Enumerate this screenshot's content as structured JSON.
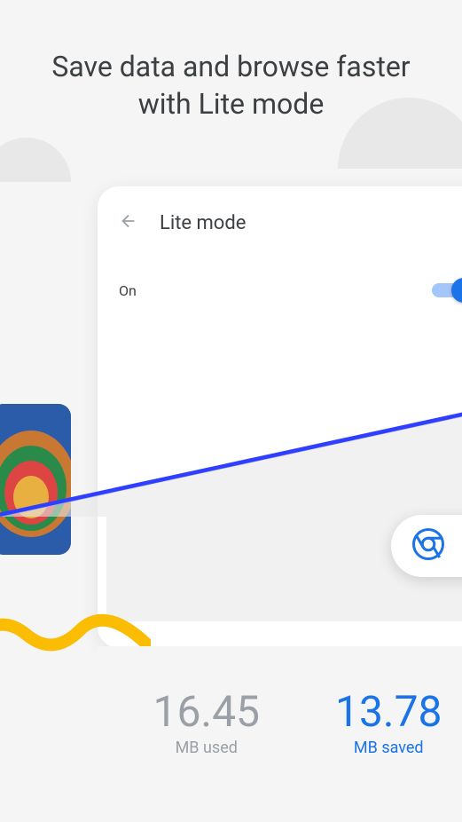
{
  "heading": "Save data and browse faster with Lite mode",
  "screen": {
    "title": "Lite mode",
    "toggle_label": "On",
    "toggle_state": true
  },
  "stats": {
    "used_value": "16.45",
    "used_label": "MB used",
    "saved_value": "13.78",
    "saved_label": "MB saved"
  },
  "colors": {
    "accent": "#1a73e8",
    "muted": "#9aa0a6"
  }
}
